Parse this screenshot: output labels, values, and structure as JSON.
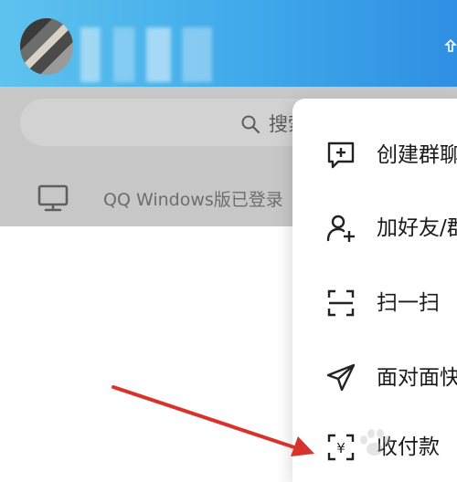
{
  "header": {
    "avatar_icon": "user-avatar",
    "right_icon": "theme-icon",
    "background_color": "#3fa9ea"
  },
  "search": {
    "icon": "search-icon",
    "placeholder": "搜索"
  },
  "device_status": {
    "icon": "monitor-icon",
    "text": "QQ Windows版已登录"
  },
  "menu": {
    "items": [
      {
        "icon": "create-group-icon",
        "label": "创建群聊"
      },
      {
        "icon": "add-friend-icon",
        "label": "加好友/群"
      },
      {
        "icon": "scan-icon",
        "label": "扫一扫"
      },
      {
        "icon": "face-to-face-icon",
        "label": "面对面快传"
      },
      {
        "icon": "receive-money-icon",
        "label": "收付款"
      }
    ]
  },
  "annotation": {
    "arrow_color": "#d8322d"
  }
}
